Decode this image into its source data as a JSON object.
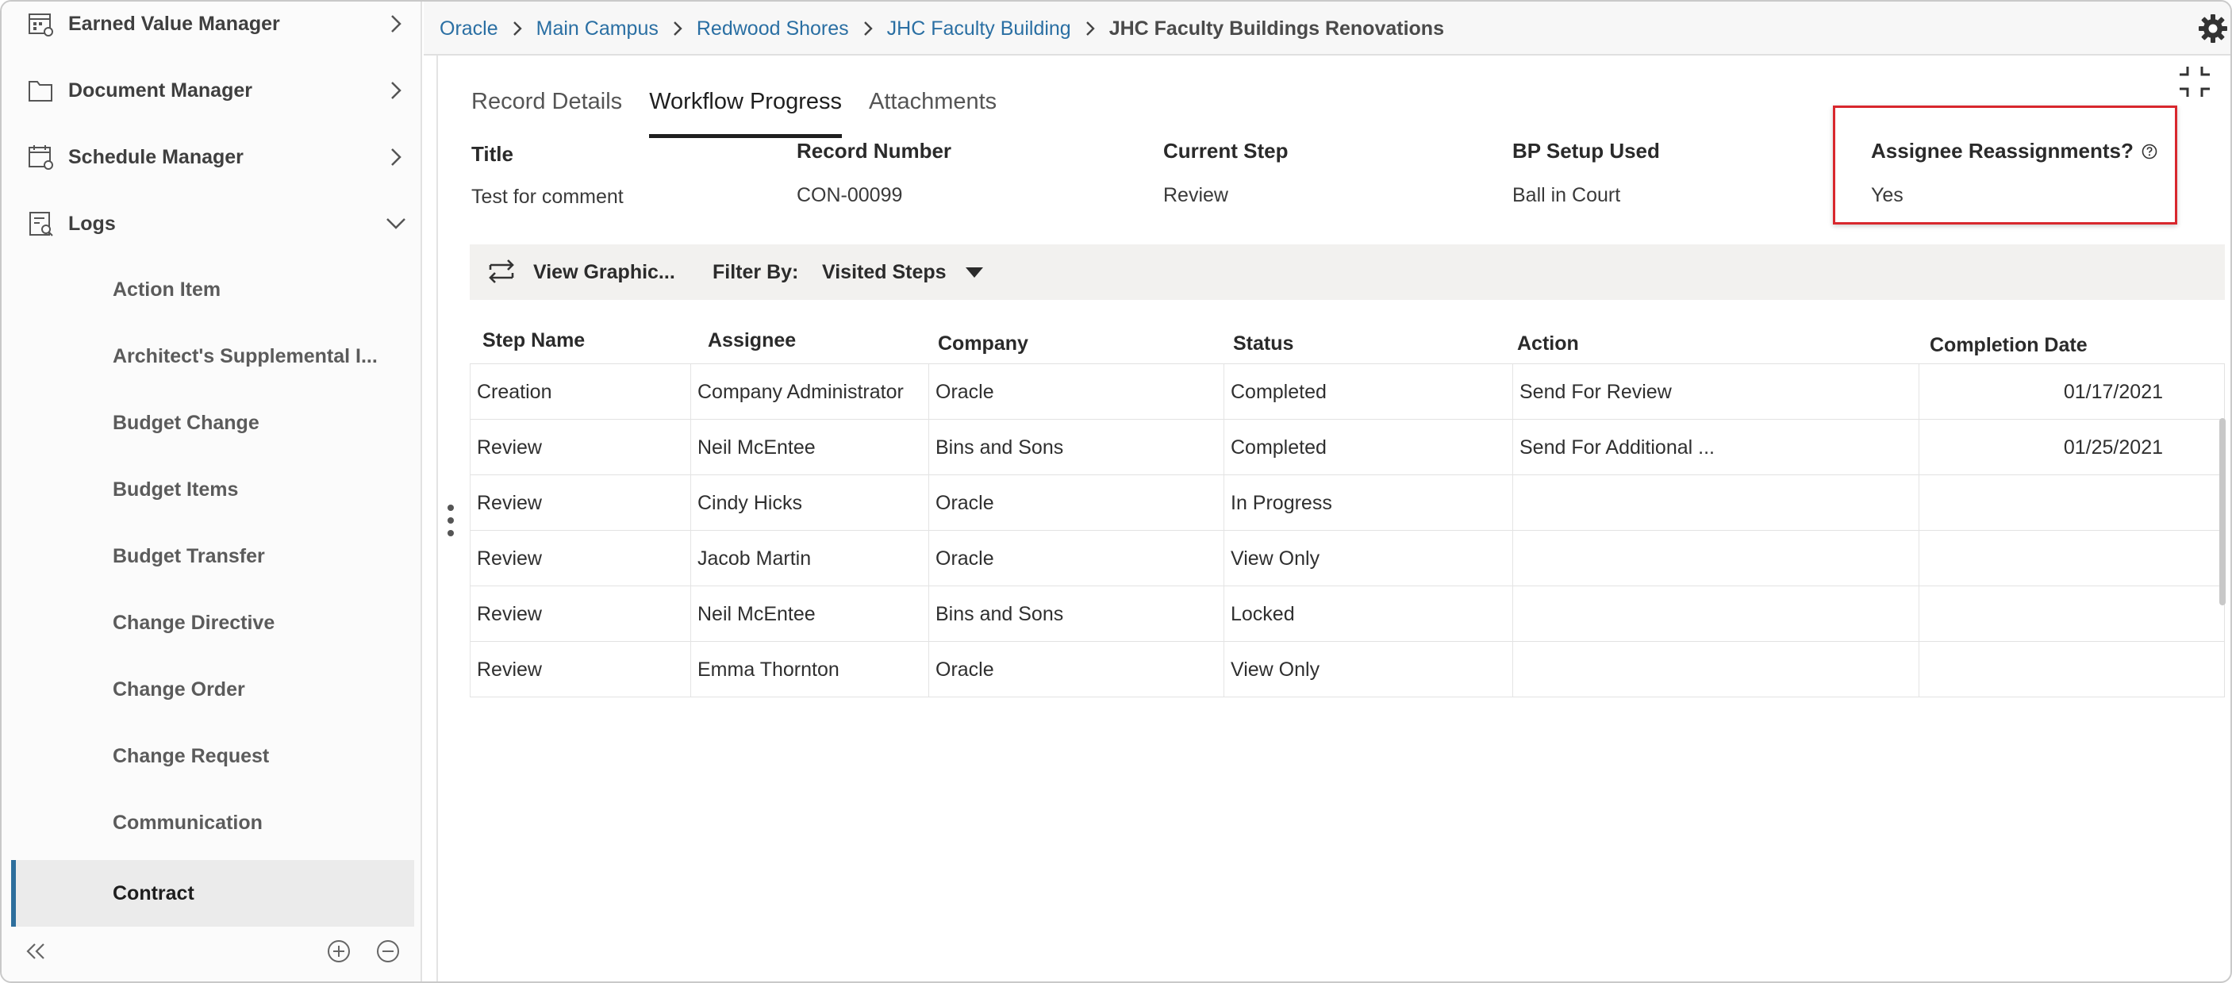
{
  "sidebar": {
    "top_items": [
      {
        "label": "Earned Value Manager",
        "icon": "calendar-chart-icon"
      },
      {
        "label": "Document Manager",
        "icon": "folder-icon"
      },
      {
        "label": "Schedule Manager",
        "icon": "calendar-clock-icon"
      },
      {
        "label": "Logs",
        "icon": "log-search-icon"
      }
    ],
    "log_items": [
      {
        "label": "Action Item"
      },
      {
        "label": "Architect's Supplemental I..."
      },
      {
        "label": "Budget Change"
      },
      {
        "label": "Budget Items"
      },
      {
        "label": "Budget Transfer"
      },
      {
        "label": "Change Directive"
      },
      {
        "label": "Change Order"
      },
      {
        "label": "Change Request"
      },
      {
        "label": "Communication"
      },
      {
        "label": "Contract"
      }
    ],
    "active_item": "Contract"
  },
  "breadcrumb": {
    "links": [
      "Oracle",
      "Main Campus",
      "Redwood Shores",
      "JHC Faculty Building"
    ],
    "current": "JHC Faculty Buildings Renovations"
  },
  "tabs": [
    "Record Details",
    "Workflow Progress",
    "Attachments"
  ],
  "active_tab": "Workflow Progress",
  "fields": {
    "title": {
      "label": "Title",
      "value": "Test for comment"
    },
    "record_number": {
      "label": "Record Number",
      "value": "CON-00099"
    },
    "current_step": {
      "label": "Current Step",
      "value": "Review"
    },
    "bp_setup": {
      "label": "BP Setup Used",
      "value": "Ball in Court"
    },
    "reassign": {
      "label": "Assignee Reassignments?",
      "value": "Yes"
    }
  },
  "toolbar": {
    "view_graphic": "View Graphic...",
    "filter_label": "Filter By:",
    "filter_value": "Visited Steps"
  },
  "grid": {
    "columns": [
      "Step Name",
      "Assignee",
      "Company",
      "Status",
      "Action",
      "Completion Date"
    ],
    "rows": [
      [
        "Creation",
        "Company Administrator",
        "Oracle",
        "Completed",
        "Send For Review",
        "01/17/2021"
      ],
      [
        "Review",
        "Neil McEntee",
        "Bins and Sons",
        "Completed",
        "Send For Additional ...",
        "01/25/2021"
      ],
      [
        "Review",
        "Cindy Hicks",
        "Oracle",
        "In Progress",
        "",
        ""
      ],
      [
        "Review",
        "Jacob Martin",
        "Oracle",
        "View Only",
        "",
        ""
      ],
      [
        "Review",
        "Neil McEntee",
        "Bins and Sons",
        "Locked",
        "",
        ""
      ],
      [
        "Review",
        "Emma Thornton",
        "Oracle",
        "View Only",
        "",
        ""
      ]
    ]
  },
  "colors": {
    "accent": "#2a6fa3",
    "highlight": "#d8272d",
    "active_bar": "#2d6e9c"
  }
}
